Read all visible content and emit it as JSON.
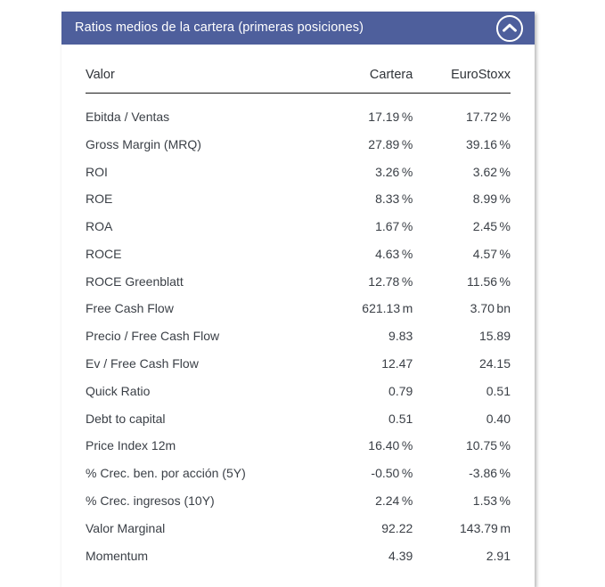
{
  "card": {
    "header": {
      "title": "Ratios medios de la cartera (primeras posiciones)",
      "collapse_icon": "chevron-up-icon",
      "background_color": "#4e5f9c",
      "title_color": "#ffffff"
    },
    "table": {
      "columns": [
        {
          "key": "valor",
          "label": "Valor",
          "align": "left"
        },
        {
          "key": "cartera",
          "label": "Cartera",
          "align": "right"
        },
        {
          "key": "eurostoxx",
          "label": "EuroStoxx",
          "align": "right"
        }
      ],
      "rows": [
        {
          "valor": "Ebitda / Ventas",
          "cartera": "17.19",
          "cartera_unit": "%",
          "eurostoxx": "17.72",
          "eurostoxx_unit": "%"
        },
        {
          "valor": "Gross Margin (MRQ)",
          "cartera": "27.89",
          "cartera_unit": "%",
          "eurostoxx": "39.16",
          "eurostoxx_unit": "%"
        },
        {
          "valor": "ROI",
          "cartera": "3.26",
          "cartera_unit": "%",
          "eurostoxx": "3.62",
          "eurostoxx_unit": "%"
        },
        {
          "valor": "ROE",
          "cartera": "8.33",
          "cartera_unit": "%",
          "eurostoxx": "8.99",
          "eurostoxx_unit": "%"
        },
        {
          "valor": "ROA",
          "cartera": "1.67",
          "cartera_unit": "%",
          "eurostoxx": "2.45",
          "eurostoxx_unit": "%"
        },
        {
          "valor": "ROCE",
          "cartera": "4.63",
          "cartera_unit": "%",
          "eurostoxx": "4.57",
          "eurostoxx_unit": "%"
        },
        {
          "valor": "ROCE Greenblatt",
          "cartera": "12.78",
          "cartera_unit": "%",
          "eurostoxx": "11.56",
          "eurostoxx_unit": "%"
        },
        {
          "valor": "Free Cash Flow",
          "cartera": "621.13",
          "cartera_unit": "m",
          "eurostoxx": "3.70",
          "eurostoxx_unit": "bn"
        },
        {
          "valor": "Precio / Free Cash Flow",
          "cartera": "9.83",
          "cartera_unit": "",
          "eurostoxx": "15.89",
          "eurostoxx_unit": ""
        },
        {
          "valor": "Ev / Free Cash Flow",
          "cartera": "12.47",
          "cartera_unit": "",
          "eurostoxx": "24.15",
          "eurostoxx_unit": ""
        },
        {
          "valor": "Quick Ratio",
          "cartera": "0.79",
          "cartera_unit": "",
          "eurostoxx": "0.51",
          "eurostoxx_unit": ""
        },
        {
          "valor": "Debt to capital",
          "cartera": "0.51",
          "cartera_unit": "",
          "eurostoxx": "0.40",
          "eurostoxx_unit": ""
        },
        {
          "valor": "Price Index 12m",
          "cartera": "16.40",
          "cartera_unit": "%",
          "eurostoxx": "10.75",
          "eurostoxx_unit": "%"
        },
        {
          "valor": "% Crec. ben. por acción (5Y)",
          "cartera": "-0.50",
          "cartera_unit": "%",
          "eurostoxx": "-3.86",
          "eurostoxx_unit": "%"
        },
        {
          "valor": "% Crec. ingresos (10Y)",
          "cartera": "2.24",
          "cartera_unit": "%",
          "eurostoxx": "1.53",
          "eurostoxx_unit": "%"
        },
        {
          "valor": "Valor Marginal",
          "cartera": "92.22",
          "cartera_unit": "",
          "eurostoxx": "143.79",
          "eurostoxx_unit": "m"
        },
        {
          "valor": "Momentum",
          "cartera": "4.39",
          "cartera_unit": "",
          "eurostoxx": "2.91",
          "eurostoxx_unit": ""
        }
      ]
    }
  }
}
